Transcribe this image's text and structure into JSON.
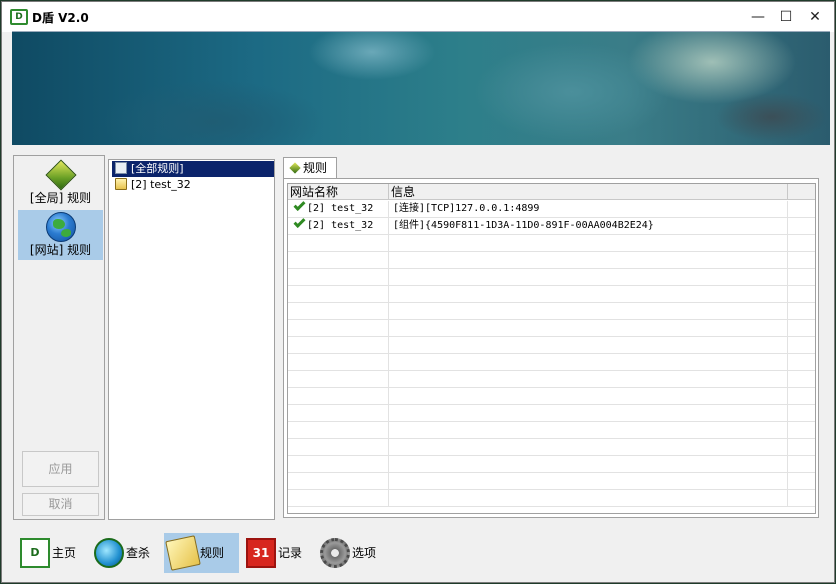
{
  "window": {
    "title": "D盾 V2.0",
    "icon_text": "D",
    "controls": {
      "minimize": "—",
      "maximize": "☐",
      "close": "✕"
    }
  },
  "categories": [
    {
      "label": "[全局] 规则",
      "icon": "diamond-icon",
      "selected": false
    },
    {
      "label": "[网站] 规则",
      "icon": "globe-icon",
      "selected": true
    }
  ],
  "left_buttons": {
    "apply": "应用",
    "cancel": "取消"
  },
  "tree": [
    {
      "label": "[全部规则]",
      "icon": "all-rules-icon",
      "selected": true
    },
    {
      "label": "[2] test_32",
      "icon": "folder-icon",
      "selected": false
    }
  ],
  "tab": {
    "label": "规则",
    "icon": "rule-tab-icon"
  },
  "grid": {
    "columns": [
      "网站名称",
      "信息"
    ],
    "rows": [
      {
        "status": "check",
        "site": "[2] test_32",
        "info": "[连接][TCP]127.0.0.1:4899"
      },
      {
        "status": "check",
        "site": "[2] test_32",
        "info": "[组件]{4590F811-1D3A-11D0-891F-00AA004B2E24}"
      }
    ]
  },
  "bottom_nav": [
    {
      "label": "主页",
      "icon": "home-icon",
      "selected": false
    },
    {
      "label": "查杀",
      "icon": "scan-icon",
      "selected": false
    },
    {
      "label": "规则",
      "icon": "rules-icon",
      "selected": true
    },
    {
      "label": "记录",
      "icon": "log-icon",
      "selected": false
    },
    {
      "label": "选项",
      "icon": "options-icon",
      "selected": false
    }
  ],
  "colors": {
    "selection": "#a9cbe8",
    "tree_selection": "#0b246b",
    "brand_green": "#2e8b2e"
  }
}
